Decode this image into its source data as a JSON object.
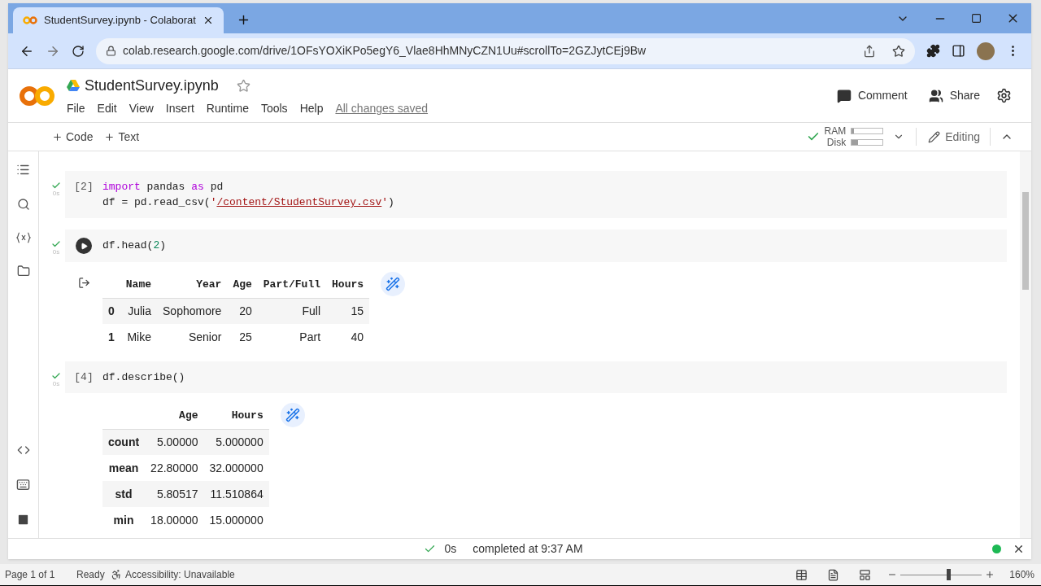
{
  "browser": {
    "tab": {
      "title": "StudentSurvey.ipynb - Colaborat",
      "selected": true
    },
    "url": "colab.research.google.com/drive/1OFsYOXiKPo5egY6_Vlae8HhMNyCZN1Uu#scrollTo=2GZJytCEj9Bw"
  },
  "notebook": {
    "title": "StudentSurvey.ipynb",
    "starred": false,
    "menu": [
      "File",
      "Edit",
      "View",
      "Insert",
      "Runtime",
      "Tools",
      "Help"
    ],
    "save_status": "All changes saved",
    "actions": [
      "Comment",
      "Share"
    ]
  },
  "toolbar": {
    "add_buttons": [
      "Code",
      "Text"
    ],
    "connected": true,
    "ram": {
      "label": "RAM",
      "level": 0.08
    },
    "disk": {
      "label": "Disk",
      "level": 0.2
    },
    "mode": "Editing"
  },
  "cells": [
    {
      "hovered": false,
      "prompt": "[2]",
      "done": true,
      "time": "0s",
      "lines": [
        [
          {
            "kind": "keyword",
            "text": "import"
          },
          {
            "kind": "plain",
            "text": " pandas "
          },
          {
            "kind": "keyword",
            "text": "as"
          },
          {
            "kind": "plain",
            "text": " pd"
          }
        ],
        [
          {
            "kind": "plain",
            "text": "df = pd.read_csv("
          },
          {
            "kind": "string",
            "text": "'"
          },
          {
            "kind": "path",
            "text": "/content/StudentSurvey.csv"
          },
          {
            "kind": "string",
            "text": "'"
          },
          {
            "kind": "plain",
            "text": ")"
          }
        ]
      ]
    },
    {
      "hovered": true,
      "done": true,
      "time": "0s",
      "lines": [
        [
          {
            "kind": "plain",
            "text": "df.head("
          },
          {
            "kind": "number",
            "text": "2"
          },
          {
            "kind": "plain",
            "text": ")"
          }
        ]
      ],
      "output": {
        "columns": [
          "Name",
          "Year",
          "Age",
          "Part/Full",
          "Hours"
        ],
        "rows": [
          {
            "index": "0",
            "values": [
              "Julia",
              "Sophomore",
              "20",
              "Full",
              "15"
            ]
          },
          {
            "index": "1",
            "values": [
              "Mike",
              "Senior",
              "25",
              "Part",
              "40"
            ]
          }
        ]
      }
    },
    {
      "hovered": false,
      "prompt": "[4]",
      "done": true,
      "time": "0s",
      "lines": [
        [
          {
            "kind": "plain",
            "text": "df.describe()"
          }
        ]
      ],
      "output": {
        "columns": [
          "Age",
          "Hours"
        ],
        "rows": [
          {
            "index": "count",
            "values": [
              "5.00000",
              "5.000000"
            ]
          },
          {
            "index": "mean",
            "values": [
              "22.80000",
              "32.000000"
            ]
          },
          {
            "index": "std",
            "values": [
              "5.80517",
              "11.510864"
            ]
          },
          {
            "index": "min",
            "values": [
              "18.00000",
              "15.000000"
            ]
          }
        ]
      }
    }
  ],
  "status_bar": {
    "done": true,
    "time": "0s",
    "message": "completed at 9:37 AM",
    "connected": true
  },
  "app_status_bar": {
    "page": "Page 1 of 1",
    "state": "Ready",
    "accessibility": "Accessibility: Unavailable",
    "zoom": {
      "level": 0.59
    },
    "zoom_label": "160%"
  }
}
